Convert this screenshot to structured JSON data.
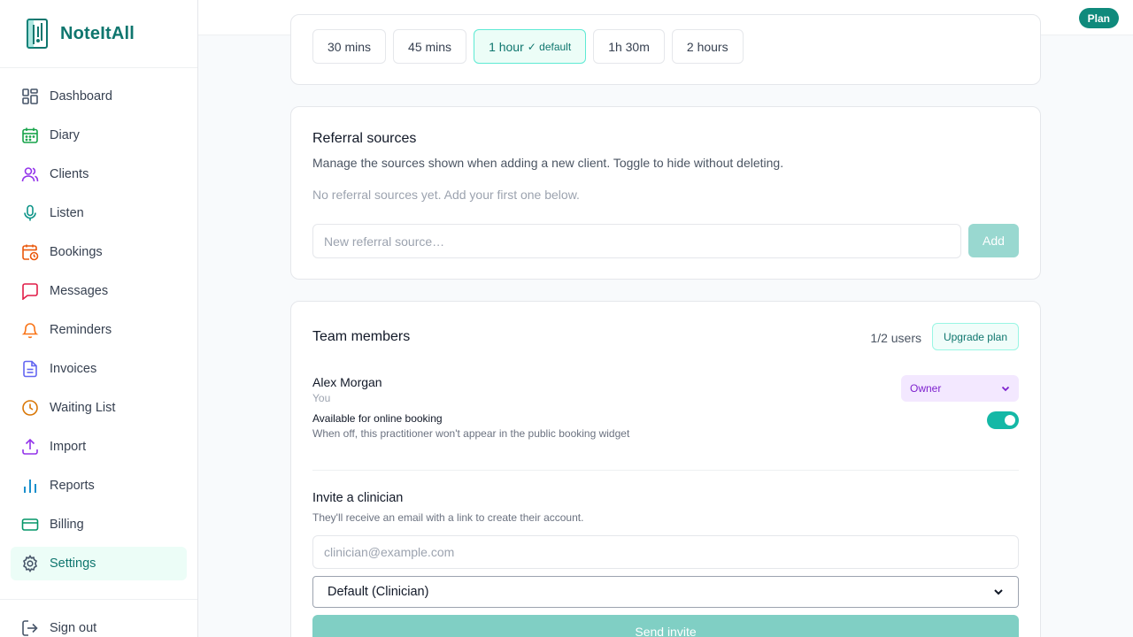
{
  "brand": {
    "name": "NoteItAll",
    "logo": "logo-icon"
  },
  "sidebar": {
    "items": [
      {
        "label": "Dashboard",
        "icon": "dashboard-icon",
        "color": "#475569"
      },
      {
        "label": "Diary",
        "icon": "calendar-icon",
        "color": "#16a34a"
      },
      {
        "label": "Clients",
        "icon": "users-icon",
        "color": "#9333ea"
      },
      {
        "label": "Listen",
        "icon": "microphone-icon",
        "color": "#0d9488"
      },
      {
        "label": "Bookings",
        "icon": "calendar-clock-icon",
        "color": "#ea580c"
      },
      {
        "label": "Messages",
        "icon": "message-icon",
        "color": "#e11d48"
      },
      {
        "label": "Reminders",
        "icon": "bell-icon",
        "color": "#f97316"
      },
      {
        "label": "Invoices",
        "icon": "document-icon",
        "color": "#6366f1"
      },
      {
        "label": "Waiting List",
        "icon": "clock-icon",
        "color": "#d97706"
      },
      {
        "label": "Import",
        "icon": "upload-icon",
        "color": "#9333ea"
      },
      {
        "label": "Reports",
        "icon": "bar-chart-icon",
        "color": "#0284c7"
      },
      {
        "label": "Billing",
        "icon": "credit-card-icon",
        "color": "#059669"
      },
      {
        "label": "Settings",
        "icon": "gear-icon",
        "color": "#475569"
      }
    ],
    "signout": "Sign out"
  },
  "topbar": {
    "plan_label": "Plan"
  },
  "durations": {
    "options": [
      "30 mins",
      "45 mins",
      "1 hour",
      "1h 30m",
      "2 hours"
    ],
    "default_tag": "✓ default"
  },
  "referral": {
    "title": "Referral sources",
    "description": "Manage the sources shown when adding a new client. Toggle to hide without deleting.",
    "empty": "No referral sources yet. Add your first one below.",
    "placeholder": "New referral source…",
    "add_label": "Add"
  },
  "team": {
    "title": "Team members",
    "users": "1/2 users",
    "upgrade_label": "Upgrade plan",
    "member": {
      "name": "Alex Morgan",
      "you": "You",
      "role": "Owner"
    },
    "availability_label": "Available for online booking",
    "availability_help": "When off, this practitioner won't appear in the public booking widget",
    "invite_title": "Invite a clinician",
    "invite_sub": "They'll receive an email with a link to create their account.",
    "email_placeholder": "clinician@example.com",
    "role_default": "Default (Clinician)",
    "send_label": "Send invite"
  }
}
